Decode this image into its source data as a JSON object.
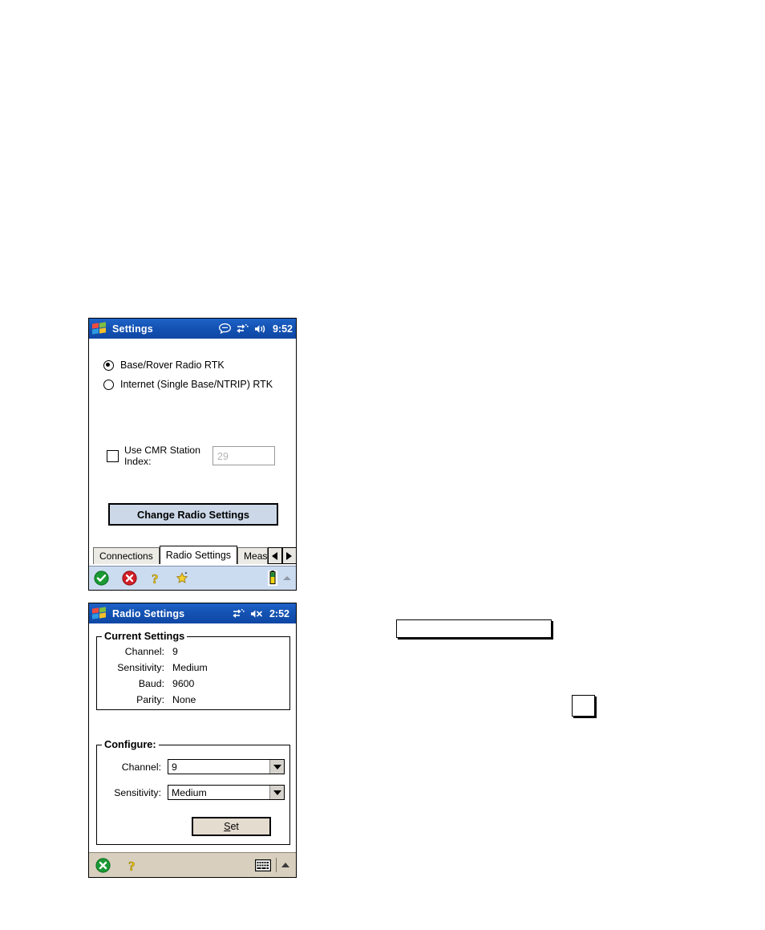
{
  "page": {
    "background": "#ffffff"
  },
  "window_settings": {
    "titlebar": {
      "title": "Settings",
      "flag_icon": "windows-flag-icon",
      "icons": [
        "chat-bubble-icon",
        "connectivity-icon",
        "speaker-icon"
      ],
      "clock": "9:52",
      "bg_color": "#0f47a4"
    },
    "radio_options": [
      {
        "label": "Base/Rover Radio RTK",
        "selected": true
      },
      {
        "label": "Internet (Single Base/NTRIP) RTK",
        "selected": false
      }
    ],
    "checkbox": {
      "label_line1": "Use CMR Station",
      "label_line2": "Index:",
      "checked": false
    },
    "station_index_field": {
      "value": "29",
      "placeholder": "29",
      "disabled": true,
      "text_color": "#b4b4b4"
    },
    "primary_button": {
      "label": "Change Radio Settings",
      "color": "#ccd8e8"
    },
    "tabs": [
      {
        "label": "Connections",
        "active": false
      },
      {
        "label": "Radio Settings",
        "active": true
      },
      {
        "label": "Meas",
        "active": false,
        "clipped": true
      }
    ],
    "tab_scroll": {
      "left": "scroll-left-arrow",
      "right": "scroll-right-arrow"
    },
    "command_bar": {
      "icons": [
        "ok-check-icon",
        "cancel-x-icon",
        "help-question-icon",
        "star-icon"
      ],
      "right_icons": [
        "battery-icon",
        "expand-up-arrow-icon"
      ],
      "bg_color": "#ccdcf0"
    }
  },
  "window_radio": {
    "titlebar": {
      "title": "Radio Settings",
      "flag_icon": "windows-flag-icon",
      "icons": [
        "connectivity-icon",
        "speaker-muted-icon"
      ],
      "clock": "2:52",
      "bg_color": "#0f47a4"
    },
    "current_settings": {
      "group_title": "Current Settings",
      "rows": [
        {
          "key": "Channel:",
          "value": "9"
        },
        {
          "key": "Sensitivity:",
          "value": "Medium"
        },
        {
          "key": "Baud:",
          "value": "9600"
        },
        {
          "key": "Parity:",
          "value": "None"
        }
      ]
    },
    "configure": {
      "group_title": "Configure:",
      "fields": [
        {
          "key": "Channel:",
          "value": "9"
        },
        {
          "key": "Sensitivity:",
          "value": "Medium"
        }
      ],
      "set_button": {
        "label_prefix": "S",
        "label_rest": "et",
        "color": "#e4dccf"
      }
    },
    "command_bar": {
      "icons": [
        "cancel-x-icon",
        "help-question-icon"
      ],
      "right_icons": [
        "keyboard-icon",
        "expand-up-arrow-icon"
      ],
      "bg_color": "#d8cfbe"
    }
  },
  "callouts": [
    {
      "name": "empty-callout-box-large"
    },
    {
      "name": "empty-callout-box-small"
    }
  ]
}
